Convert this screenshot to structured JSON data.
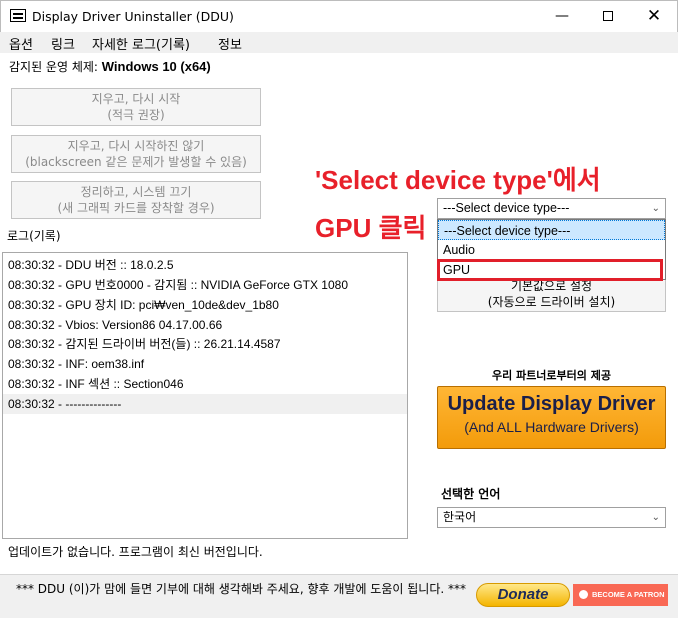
{
  "window": {
    "title": "Display Driver Uninstaller (DDU)",
    "controls": {
      "minimize": "—",
      "maximize": "",
      "close": "✕"
    }
  },
  "menu": [
    "옵션",
    "링크",
    "자세한 로그(기록)",
    "정보"
  ],
  "os": {
    "label": "감지된 운영 체제:",
    "value": "Windows 10 (x64)"
  },
  "actions": [
    {
      "line1": "지우고, 다시 시작",
      "line2": "(적극 권장)"
    },
    {
      "line1": "지우고, 다시 시작하진 않기",
      "line2": "(blackscreen 같은 문제가 발생할 수 있음)"
    },
    {
      "line1": "정리하고, 시스템 끄기",
      "line2": "(새 그래픽 카드를 장착할 경우)"
    }
  ],
  "log": {
    "label": "로그(기록)",
    "lines": [
      "08:30:32 - DDU 버전 :: 18.0.2.5",
      "08:30:32 - GPU 번호0000 - 감지됨 :: NVIDIA GeForce GTX 1080",
      "08:30:32 - GPU 장치 ID: pci₩ven_10de&dev_1b80",
      "08:30:32 - Vbios: Version86 04.17.00.66",
      "08:30:32 - 감지된 드라이버 버전(들) :: 26.21.14.4587",
      "08:30:32 - INF: oem38.inf",
      "08:30:32 - INF 섹션 :: Section046",
      "08:30:32 - --------------"
    ]
  },
  "status": "업데이트가 없습니다.  프로그램이 최신 버전입니다.",
  "annotation": {
    "line1": "'Select device type'에서",
    "line2": "GPU 클릭"
  },
  "device": {
    "selected": "---Select device type---",
    "arrow": "⌄",
    "options": [
      "---Select device type---",
      "Audio",
      "GPU"
    ]
  },
  "restore": {
    "line1": "기본값으로 설정",
    "line2": "(자동으로 드라이버 설치)"
  },
  "partner": {
    "label": "우리 파트너로부터의 제공",
    "title": "Update Display Driver",
    "subtitle": "(And ALL Hardware Drivers)"
  },
  "language": {
    "label": "선택한 언어",
    "value": "한국어",
    "arrow": "⌄"
  },
  "footer": {
    "text": "*** DDU (이)가 맘에 들면 기부에 대해 생각해봐 주세요, 향후 개발에 도움이 됩니다. ***",
    "donate": "Donate",
    "patron": "BECOME A PATRON"
  },
  "colors": {
    "annotation": "#e8202a",
    "highlight_border": "#e11f2a",
    "update_orange": "#f39b0a",
    "patron": "#f96854"
  }
}
